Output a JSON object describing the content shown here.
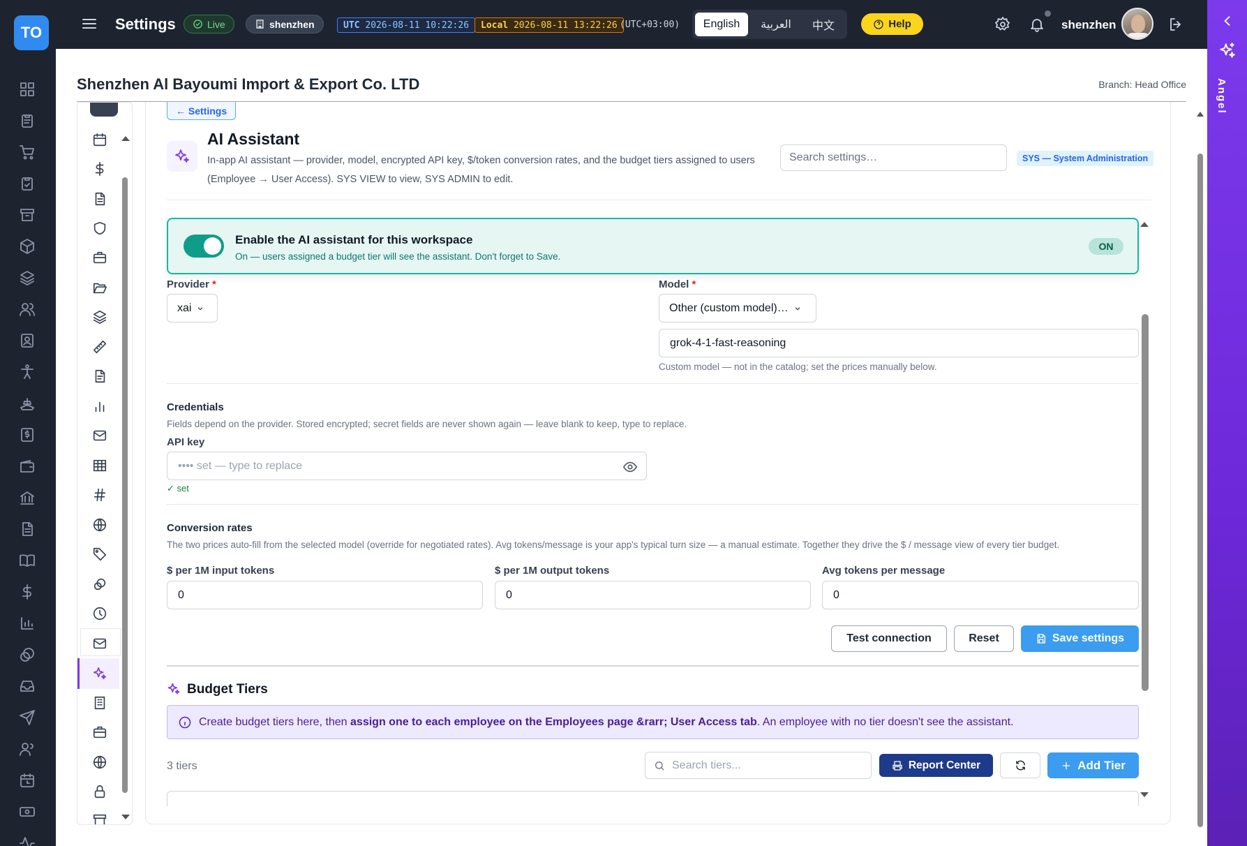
{
  "brand": {
    "logo_text": "TO"
  },
  "topbar": {
    "title": "Settings",
    "live_label": "Live",
    "workspace_label": "shenzhen",
    "utc_prefix": "UTC",
    "utc_time": "2026-08-11 10:22:26",
    "local_prefix": "Local",
    "local_time": "2026-08-11 13:22:26",
    "tz_offset": "(UTC+03:00)",
    "languages": [
      "English",
      "العربية",
      "中文"
    ],
    "active_language": "English",
    "help_label": "Help",
    "username": "shenzhen"
  },
  "assistant_panel": {
    "label": "Angel"
  },
  "page_header": {
    "company": "Shenzhen Al Bayoumi Import & Export Co. LTD",
    "branch": "Branch: Head Office"
  },
  "settings": {
    "back_label": "← Settings",
    "title": "AI Assistant",
    "description": "In-app AI assistant — provider, model, encrypted API key, $/token conversion rates, and the budget tiers assigned to users (Employee → User Access). SYS VIEW to view, SYS ADMIN to edit.",
    "search_placeholder": "Search settings…",
    "module_badge": "SYS — System Administration"
  },
  "enable": {
    "title": "Enable the AI assistant for this workspace",
    "subtitle": "On — users assigned a budget tier will see the assistant. Don't forget to Save.",
    "state_badge": "ON",
    "enabled": true
  },
  "provider": {
    "label": "Provider",
    "required": "*",
    "value": "xai"
  },
  "model": {
    "label": "Model",
    "required": "*",
    "value": "Other (custom model)…",
    "custom_value": "grok-4-1-fast-reasoning",
    "hint": "Custom model — not in the catalog; set the prices manually below."
  },
  "credentials": {
    "title": "Credentials",
    "hint": "Fields depend on the provider. Stored encrypted; secret fields are never shown again — leave blank to keep, type to replace.",
    "api_key_label": "API key",
    "api_key_placeholder": "•••• set — type to replace",
    "api_key_status": "✓ set"
  },
  "conversion": {
    "title": "Conversion rates",
    "hint": "The two prices auto-fill from the selected model (override for negotiated rates). Avg tokens/message is your app's typical turn size — a manual estimate. Together they drive the $ / message view of every tier budget.",
    "input_label": "$ per 1M input tokens",
    "input_value": "0",
    "output_label": "$ per 1M output tokens",
    "output_value": "0",
    "avg_label": "Avg tokens per message",
    "avg_value": "0"
  },
  "actions": {
    "test_label": "Test connection",
    "reset_label": "Reset",
    "save_label": "Save settings"
  },
  "budget": {
    "title": "Budget Tiers",
    "info_prefix": "Create budget tiers here, then ",
    "info_bold": "assign one to each employee on the Employees page &rarr; User Access tab",
    "info_suffix": ". An employee with no tier doesn't see the assistant.",
    "count_label": "3 tiers",
    "search_placeholder": "Search tiers...",
    "report_label": "Report Center",
    "add_label": "Add Tier"
  },
  "colors": {
    "rail_bg": "#1e2330",
    "accent_purple": "#7c3aed",
    "accent_teal": "#14b8a6",
    "primary_blue": "#3b9cf0",
    "navy": "#1e3a8a",
    "help_yellow": "#fbd41c"
  }
}
